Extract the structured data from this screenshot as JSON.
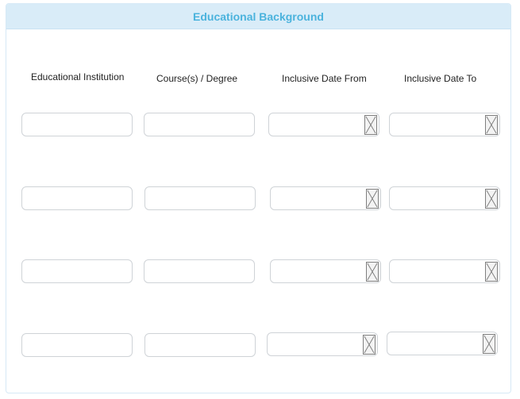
{
  "section": {
    "title": "Educational Background"
  },
  "columns": {
    "institution": "Educational Institution",
    "course": "Course(s) / Degree",
    "date_from": "Inclusive Date From",
    "date_to": "Inclusive Date To"
  },
  "rows": [
    {
      "institution": "",
      "course": "",
      "date_from": "",
      "date_to": ""
    },
    {
      "institution": "",
      "course": "",
      "date_from": "",
      "date_to": ""
    },
    {
      "institution": "",
      "course": "",
      "date_from": "",
      "date_to": ""
    },
    {
      "institution": "",
      "course": "",
      "date_from": "",
      "date_to": ""
    }
  ],
  "icons": {
    "date_picker": "date-picker-icon"
  }
}
